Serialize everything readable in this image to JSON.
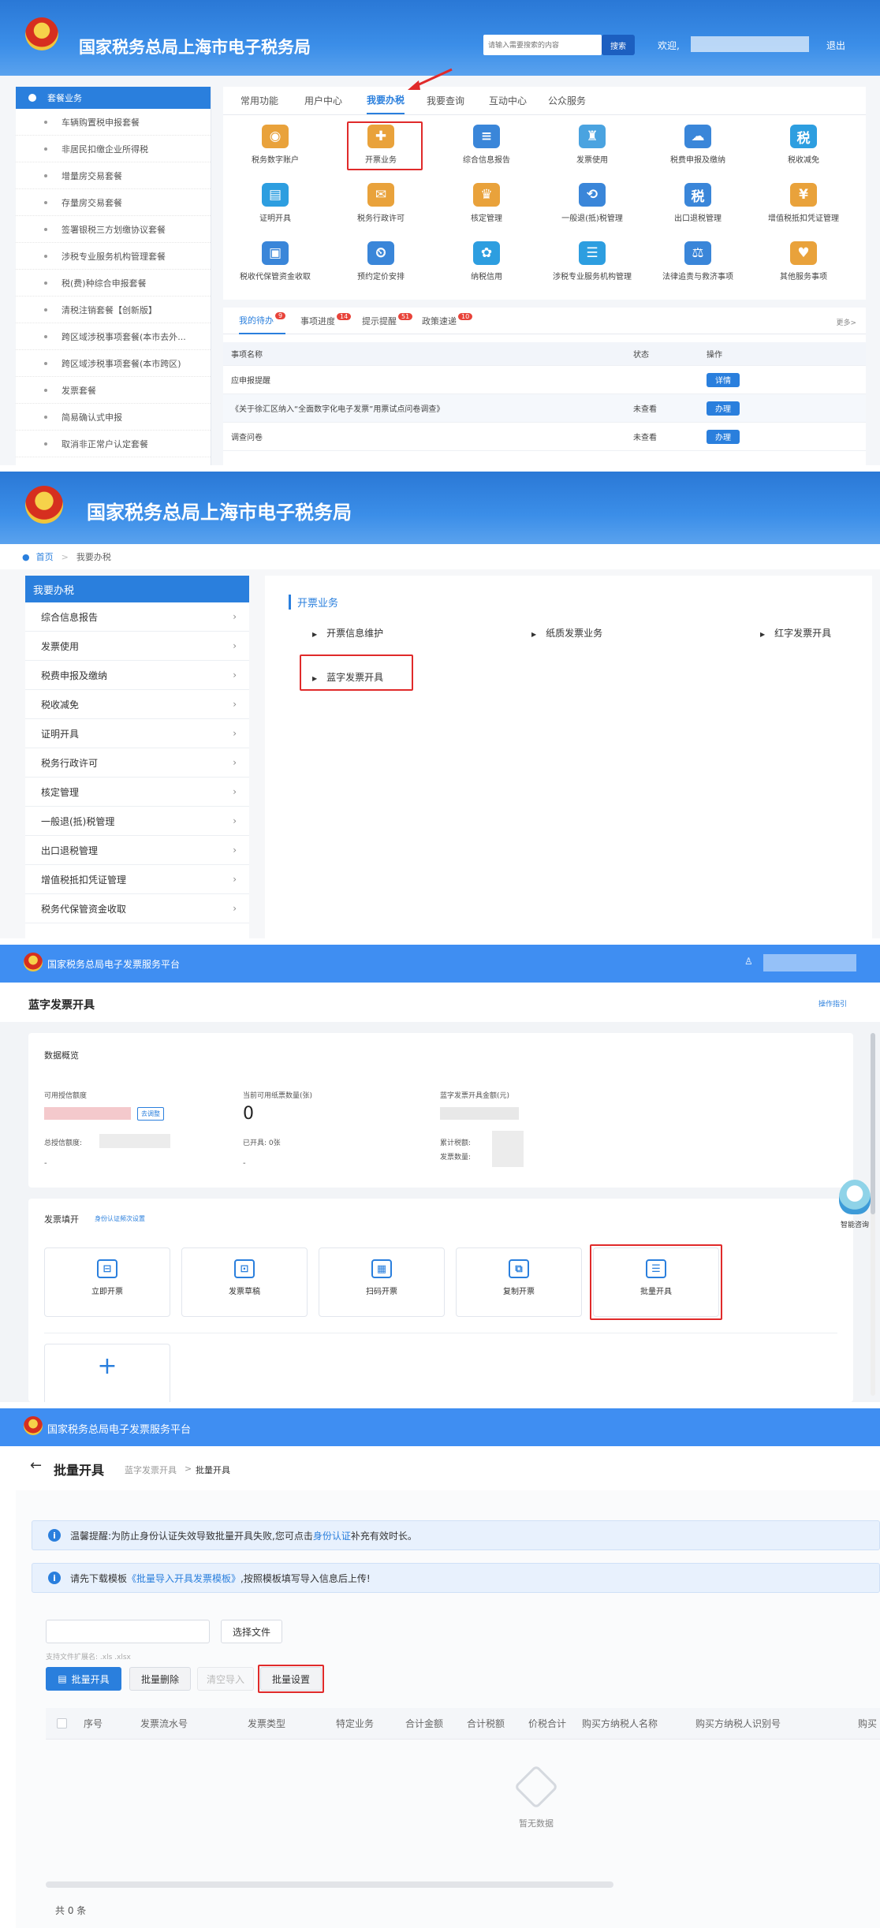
{
  "s1": {
    "title": "国家税务总局上海市电子税务局",
    "search_placeholder": "请输入需要搜索的内容",
    "search_btn": "搜索",
    "welcome": "欢迎,",
    "logout": "退出",
    "side_header": "套餐业务",
    "side_items": [
      "车辆购置税申报套餐",
      "非居民扣缴企业所得税",
      "增量房交易套餐",
      "存量房交易套餐",
      "签署银税三方划缴协议套餐",
      "涉税专业服务机构管理套餐",
      "税(费)种综合申报套餐",
      "清税注销套餐【创新版】",
      "跨区域涉税事项套餐(本市去外...",
      "跨区域涉税事项套餐(本市跨区)",
      "发票套餐",
      "简易确认式申报",
      "取消非正常户认定套餐"
    ],
    "tabs": [
      "常用功能",
      "用户中心",
      "我要办税",
      "我要查询",
      "互动中心",
      "公众服务"
    ],
    "icons": [
      [
        "税务数字账户",
        "开票业务",
        "综合信息报告",
        "发票使用",
        "税费申报及缴纳",
        "税收减免"
      ],
      [
        "证明开具",
        "税务行政许可",
        "核定管理",
        "一般退(抵)税管理",
        "出口退税管理",
        "增值税抵扣凭证管理"
      ],
      [
        "税收代保管资金收取",
        "预约定价安排",
        "纳税信用",
        "涉税专业服务机构管理",
        "法律追责与救济事项",
        "其他服务事项"
      ]
    ],
    "todo_tabs": [
      {
        "label": "我的待办",
        "badge": "9"
      },
      {
        "label": "事项进度",
        "badge": "14"
      },
      {
        "label": "提示提醒",
        "badge": "51"
      },
      {
        "label": "政策速递",
        "badge": "10"
      }
    ],
    "more": "更多>",
    "table_headers": [
      "事项名称",
      "状态",
      "操作"
    ],
    "rows": [
      {
        "name": "应申报提醒",
        "status": "",
        "action": "详情"
      },
      {
        "name": "《关于徐汇区纳入“全面数字化电子发票”用票试点问卷调查》",
        "status": "未查看",
        "action": "办理"
      },
      {
        "name": "调查问卷",
        "status": "未查看",
        "action": "办理"
      }
    ]
  },
  "s2": {
    "title": "国家税务总局上海市电子税务局",
    "breadcrumb_home": "首页",
    "breadcrumb_current": "我要办税",
    "menu_header": "我要办税",
    "menu": [
      "综合信息报告",
      "发票使用",
      "税费申报及缴纳",
      "税收减免",
      "证明开具",
      "税务行政许可",
      "核定管理",
      "一般退(抵)税管理",
      "出口退税管理",
      "增值税抵扣凭证管理",
      "税务代保管资金收取"
    ],
    "section_title": "开票业务",
    "links": [
      "开票信息维护",
      "纸质发票业务",
      "红字发票开具",
      "蓝字发票开具"
    ]
  },
  "s3": {
    "platform": "国家税务总局电子发票服务平台",
    "page_title": "蓝字发票开具",
    "guide": "操作指引",
    "overview": "数据概览",
    "credit_label": "可用授信额度",
    "credit_btn": "去调整",
    "paper_label": "当前可用纸票数量(张)",
    "paper_value": "0",
    "amount_label": "蓝字发票开具金额(元)",
    "total_credit": "总授信额度:",
    "issued": "已开具: 0张",
    "tax_total": "累计税额:",
    "invoice_count": "发票数量:",
    "dash1": "-",
    "dash2": "-",
    "fill_title": "发票填开",
    "fill_link": "身份认证频次设置",
    "cards": [
      "立即开票",
      "发票草稿",
      "扫码开票",
      "复制开票",
      "批量开具"
    ],
    "assistant": "智能咨询"
  },
  "s4": {
    "platform": "国家税务总局电子发票服务平台",
    "page_title": "批量开具",
    "crumb1": "蓝字发票开具",
    "crumb2": "批量开具",
    "notice1_a": "温馨提醒:为防止身份认证失效导致批量开具失败,您可点击",
    "notice1_link": "身份认证",
    "notice1_b": "补充有效时长。",
    "notice2_a": "请先下载模板",
    "notice2_link": "《批量导入开具发票模板》",
    "notice2_b": ",按照模板填写导入信息后上传!",
    "choose_file": "选择文件",
    "file_hint": "支持文件扩展名: .xls .xlsx",
    "btn_issue": "批量开具",
    "btn_delete": "批量删除",
    "btn_clear": "清空导入",
    "btn_settings": "批量设置",
    "columns": [
      "序号",
      "发票流水号",
      "发票类型",
      "特定业务",
      "合计金额",
      "合计税额",
      "价税合计",
      "购买方纳税人名称",
      "购买方纳税人识别号",
      "购买"
    ],
    "empty": "暂无数据",
    "total": "共 0 条"
  }
}
